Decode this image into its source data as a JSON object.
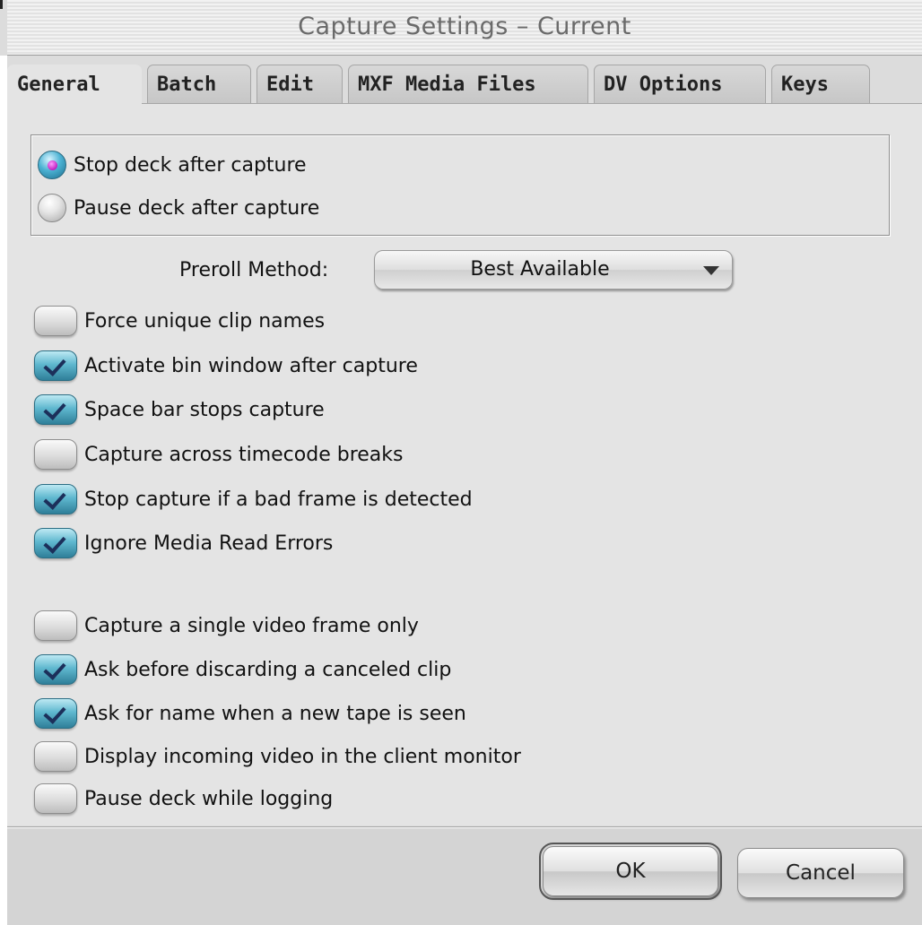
{
  "window": {
    "title": "Capture Settings – Current"
  },
  "tabs": [
    {
      "label": "General",
      "active": true
    },
    {
      "label": "Batch",
      "active": false
    },
    {
      "label": "Edit",
      "active": false
    },
    {
      "label": "MXF Media Files",
      "active": false
    },
    {
      "label": "DV Options",
      "active": false
    },
    {
      "label": "Keys",
      "active": false
    }
  ],
  "deck_after_capture": {
    "options": [
      {
        "label": "Stop deck after capture",
        "selected": true
      },
      {
        "label": "Pause deck after capture",
        "selected": false
      }
    ]
  },
  "preroll": {
    "label": "Preroll Method:",
    "value": "Best Available"
  },
  "options": [
    {
      "label": "Force unique clip names",
      "checked": false
    },
    {
      "label": "Activate bin window after capture",
      "checked": true
    },
    {
      "label": "Space bar stops capture",
      "checked": true
    },
    {
      "label": "Capture across timecode breaks",
      "checked": false
    },
    {
      "label": "Stop capture if a bad frame is detected",
      "checked": true
    },
    {
      "label": "Ignore Media Read Errors",
      "checked": true
    },
    {
      "label": "Capture a single video frame only",
      "checked": false
    },
    {
      "label": "Ask before discarding a canceled clip",
      "checked": true
    },
    {
      "label": "Ask for name when a new tape is seen",
      "checked": true
    },
    {
      "label": "Display incoming video in the client monitor",
      "checked": false
    },
    {
      "label": "Pause deck while logging",
      "checked": false
    }
  ],
  "buttons": {
    "ok": "OK",
    "cancel": "Cancel"
  }
}
